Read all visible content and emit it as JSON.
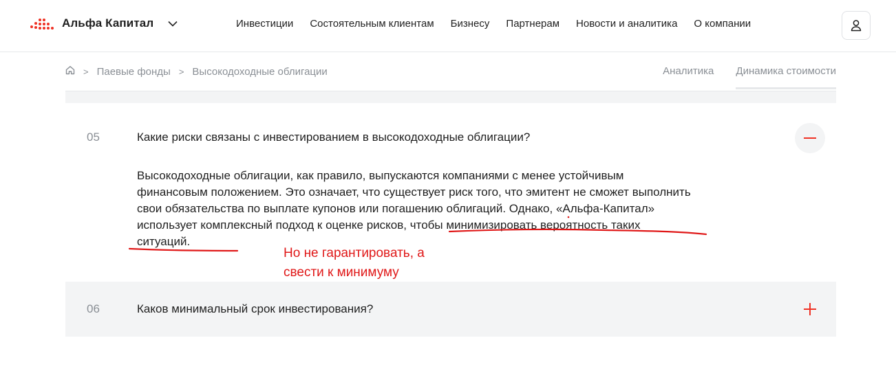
{
  "header": {
    "brand": "Альфа Капитал",
    "nav": [
      "Инвестиции",
      "Состоятельным клиентам",
      "Бизнесу",
      "Партнерам",
      "Новости и аналитика",
      "О компании"
    ]
  },
  "breadcrumb": {
    "items": [
      "Паевые фонды",
      "Высокодоходные облигации"
    ]
  },
  "subtabs": [
    "Аналитика",
    "Динамика стоимости"
  ],
  "faq": [
    {
      "number": "05",
      "question": "Какие риски связаны с инвестированием в высокодоходные облигации?",
      "answer_lines": [
        "Высокодоходные облигации, как правило, выпускаются компаниями с менее устойчивым",
        "финансовым положением. Это означает, что существует риск того, что эмитент не сможет выполнить",
        "свои обязательства по выплате купонов или погашению облигаций. Однако, «Альфа-Капитал»",
        "использует комплексный подход к оценке рисков, чтобы минимизировать вероятность таких",
        "ситуаций."
      ],
      "expanded": true
    },
    {
      "number": "06",
      "question": "Каков минимальный срок инвестирования?",
      "expanded": false
    }
  ],
  "annotation": {
    "lines": [
      "Но не гарантировать, а",
      "свести к минимуму"
    ],
    "color": "#e01818"
  },
  "colors": {
    "accent": "#ef3124",
    "muted_text": "#8a8f95",
    "panel_bg": "#f3f4f5"
  }
}
